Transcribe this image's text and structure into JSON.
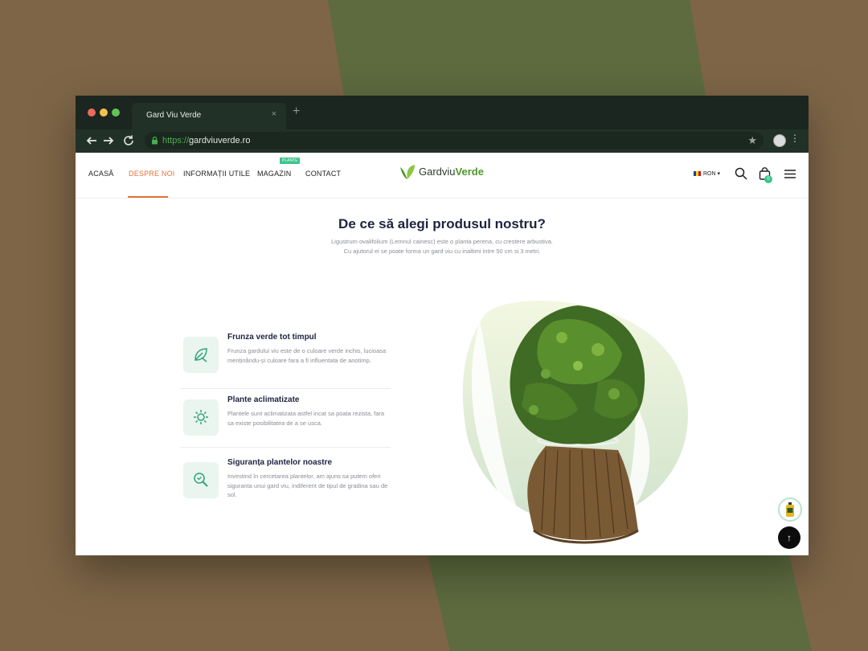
{
  "browser": {
    "tab_title": "Gard Viu Verde",
    "tab_close": "×",
    "new_tab": "+",
    "url_scheme": "https://",
    "url_host": "gardviuverde.ro"
  },
  "nav": {
    "items": [
      "ACASĂ",
      "DESPRE NOI",
      "INFORMAȚII UTILE",
      "MAGAZIN",
      "CONTACT"
    ],
    "active": "DESPRE NOI",
    "badge": "PLANTE"
  },
  "logo": {
    "text_1": "Gardviu",
    "text_2": "Verde"
  },
  "header": {
    "currency": "RON",
    "cart_count": "0"
  },
  "section": {
    "title": "De ce să alegi produsul nostru?",
    "subtitle_1": "Ligustrum ovalifolium (Lemnul cainesc) este o planta perena, cu crestere arbustiva.",
    "subtitle_2": "Cu ajutorul ei se poate forma un gard viu cu inaltimi intre 50 cm si 3 metri."
  },
  "features": [
    {
      "title": "Frunza verde tot timpul",
      "text": "Frunza gardului viu este de o culoare verde inchis, lucioasa menținându-și culoare fara a fi influentata de anotimp.",
      "icon": "leaf-icon"
    },
    {
      "title": "Plante aclimatizate",
      "text": "Plantele sunt aclimatizata astfel incat sa poata rezista, fara sa existe posibilitatea de a se usca.",
      "icon": "sun-icon"
    },
    {
      "title": "Siguranța plantelor noastre",
      "text": "Investind în cercetarea plantelor, am ajuns sa putem oferi siguranta unui gard viu, indiferent de tipul de gradina sau de sol.",
      "icon": "magnifier-icon"
    }
  ],
  "colors": {
    "accent": "#e5723a",
    "green": "#3bc48b",
    "brand_green": "#4e9a2c",
    "background": "#7e6547"
  }
}
